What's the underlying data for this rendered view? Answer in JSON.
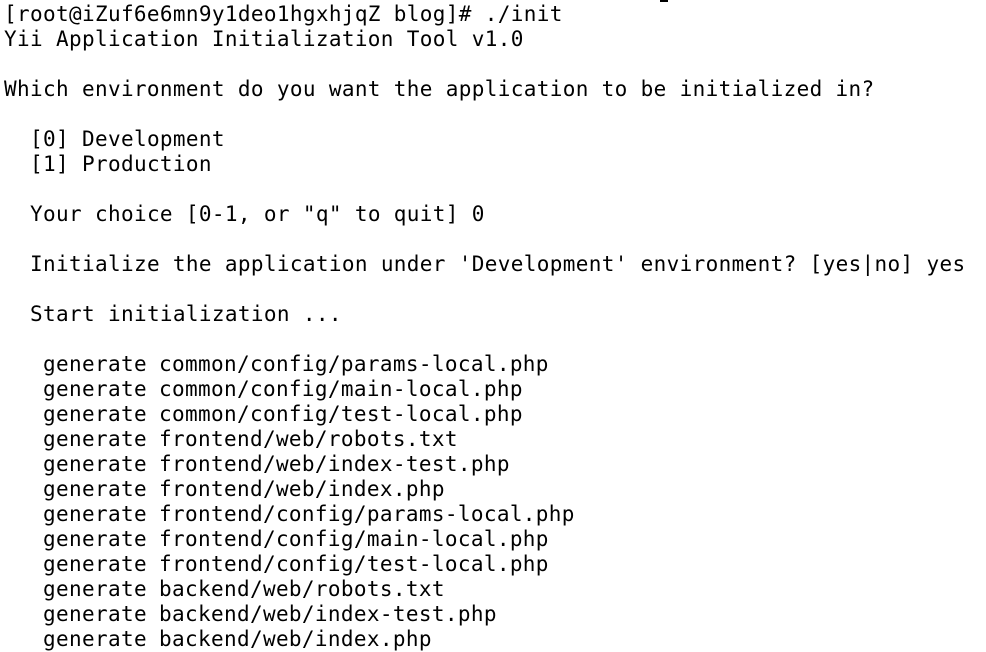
{
  "prompt": {
    "text": "[root@iZuf6e6mn9y1deo1hgxhjqZ blog]# ./init"
  },
  "header": {
    "tool_title": "Yii Application Initialization Tool v1.0"
  },
  "question": {
    "text": "Which environment do you want the application to be initialized in?"
  },
  "options": [
    {
      "label": "[0] Development"
    },
    {
      "label": "[1] Production"
    }
  ],
  "choice": {
    "text": "Your choice [0-1, or \"q\" to quit] 0"
  },
  "confirm": {
    "text": "Initialize the application under 'Development' environment? [yes|no] yes"
  },
  "status": {
    "text": "Start initialization ..."
  },
  "generated": {
    "verb": "generate",
    "files": [
      "common/config/params-local.php",
      "common/config/main-local.php",
      "common/config/test-local.php",
      "frontend/web/robots.txt",
      "frontend/web/index-test.php",
      "frontend/web/index.php",
      "frontend/config/params-local.php",
      "frontend/config/main-local.php",
      "frontend/config/test-local.php",
      "backend/web/robots.txt",
      "backend/web/index-test.php",
      "backend/web/index.php"
    ]
  }
}
